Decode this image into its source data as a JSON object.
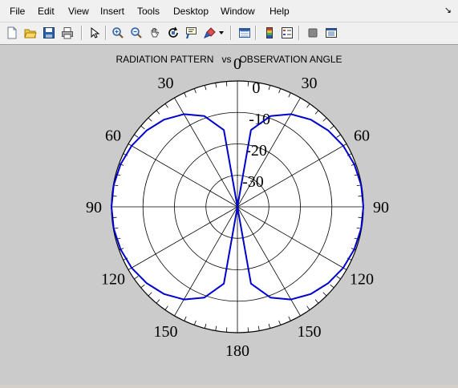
{
  "menu": [
    "File",
    "Edit",
    "View",
    "Insert",
    "Tools",
    "Desktop",
    "Window",
    "Help"
  ],
  "menu_arrow": "↘",
  "toolbar_icons": [
    "new-figure-icon",
    "open-file-icon",
    "save-icon",
    "print-icon",
    "edit-plot-arrow-icon",
    "zoom-in-icon",
    "zoom-out-icon",
    "pan-hand-icon",
    "rotate-3d-icon",
    "data-cursor-icon",
    "brush-icon",
    "brush-dropdown-icon",
    "link-plot-icon",
    "insert-colorbar-icon",
    "insert-legend-icon",
    "hide-plot-tools-icon",
    "show-plot-tools-icon"
  ],
  "colors": {
    "figure_background": "#cbcbcb",
    "plot_area": "#ffffff",
    "curve": "#0000cc",
    "grid": "#000000"
  },
  "chart_data": {
    "type": "line",
    "projection": "polar",
    "title": "RADIATION PATTERN   vs   OBSERVATION ANGLE",
    "angle_zero": "top",
    "angle_direction": "clockwise",
    "angle_ticks": [
      "0",
      "30",
      "60",
      "90",
      "120",
      "150",
      "180",
      "150",
      "120",
      "90",
      "60",
      "30"
    ],
    "radial_ticks": [
      "0",
      "-10",
      "-20",
      "-30"
    ],
    "radial_range_db": [
      -40,
      0
    ],
    "grid": true,
    "series": [
      {
        "theta_deg": [
          0,
          10,
          20,
          30,
          40,
          50,
          60,
          70,
          80,
          90,
          100,
          110,
          120,
          130,
          140,
          150,
          160,
          170,
          180
        ],
        "gain_db": [
          -40,
          -15.2,
          -9.3,
          -6.0,
          -3.8,
          -2.3,
          -1.2,
          -0.5,
          -0.1,
          0,
          -0.1,
          -0.5,
          -1.2,
          -2.3,
          -3.8,
          -6.0,
          -9.3,
          -15.2,
          -40
        ]
      }
    ]
  }
}
